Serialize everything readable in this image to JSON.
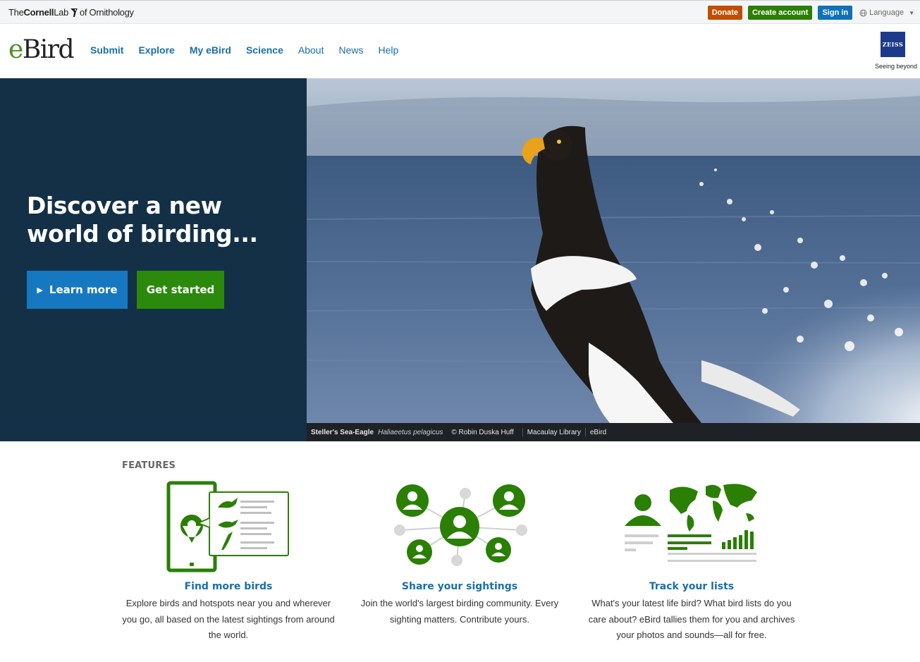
{
  "topbar": {
    "org": {
      "the": "The",
      "cornell": "Cornell",
      "lab": "Lab",
      "of": "of Ornithology"
    },
    "donate_label": "Donate",
    "create_label": "Create account",
    "signin_label": "Sign in",
    "language_label": "Language"
  },
  "header": {
    "logo_e": "e",
    "logo_rest": "Bird",
    "nav": [
      "Submit",
      "Explore",
      "My eBird",
      "Science",
      "About",
      "News",
      "Help"
    ],
    "sponsor": "ZEISS",
    "sponsor_tag": "Seeing beyond"
  },
  "hero": {
    "title": "Discover a new world of birding...",
    "learn_label": "Learn more",
    "start_label": "Get started",
    "caption": {
      "species": "Steller's Sea-Eagle",
      "scientific": "Haliaeetus pelagicus",
      "credit": "© Robin Duska Huff",
      "library": "Macaulay Library",
      "source": "eBird"
    }
  },
  "features": {
    "heading": "FEATURES",
    "items": [
      {
        "title": "Find more birds",
        "text": "Explore birds and hotspots near you and wherever you go, all based on the latest sightings from around the world."
      },
      {
        "title": "Share your sightings",
        "text": "Join the world's largest birding community. Every sighting matters. Contribute yours."
      },
      {
        "title": "Track your lists",
        "text": "What's your latest life bird? What bird lists do you care about? eBird tallies them for you and archives your photos and sounds—all for free."
      }
    ]
  },
  "colors": {
    "green": "#2a7f04",
    "blue": "#1a6fa8",
    "hero_dark": "#143047",
    "donate": "#c14d00"
  }
}
